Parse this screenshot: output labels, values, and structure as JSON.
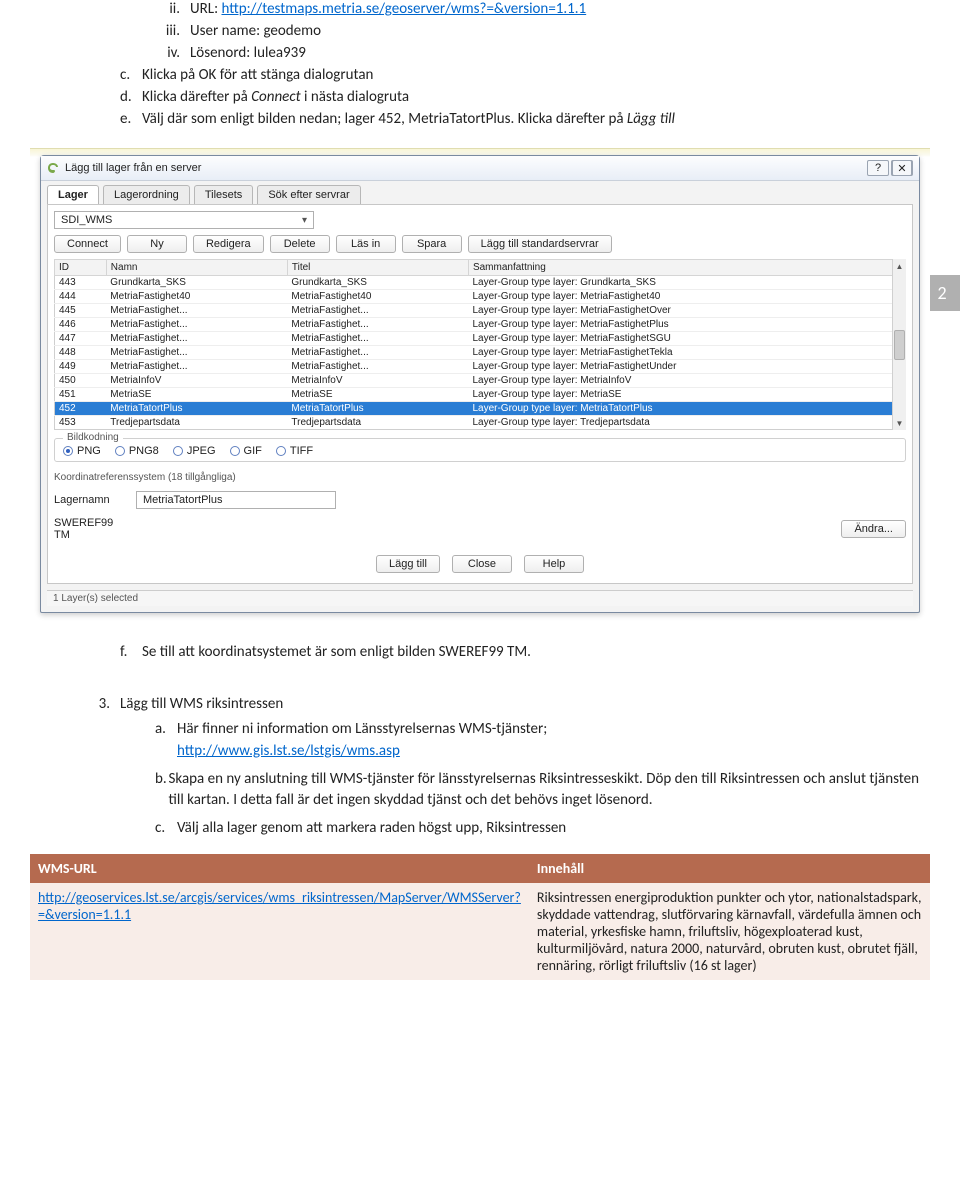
{
  "instr_top": {
    "ii_label": "ii.",
    "ii_prefix": "URL: ",
    "ii_link": "http://testmaps.metria.se/geoserver/wms?=&version=1.1.1",
    "iii_label": "iii.",
    "iii_text": "User name: geodemo",
    "iv_label": "iv.",
    "iv_text": "Lösenord: lulea939"
  },
  "letters_top": {
    "c_label": "c.",
    "c_text": "Klicka på OK för att stänga dialogrutan",
    "d_label": "d.",
    "d_prefix": "Klicka därefter på ",
    "d_italic": "Connect",
    "d_suffix": " i nästa dialogruta",
    "e_label": "e.",
    "e_prefix": "Välj där som enligt bilden nedan; lager 452, MetriaTatortPlus. Klicka därefter på ",
    "e_italic": "Lägg till"
  },
  "page_badge": "2",
  "dialog": {
    "title": "Lägg till lager från en server",
    "help_glyph": "?",
    "close_glyph": "✕",
    "tabs": [
      "Lager",
      "Lagerordning",
      "Tilesets",
      "Sök efter servrar"
    ],
    "server_selected": "SDI_WMS",
    "buttons": [
      "Connect",
      "Ny",
      "Redigera",
      "Delete",
      "Läs in",
      "Spara",
      "Lägg till standardservrar"
    ],
    "columns": [
      "ID",
      "Namn",
      "Titel",
      "Sammanfattning"
    ],
    "rows": [
      {
        "id": "443",
        "n": "Grundkarta_SKS",
        "t": "Grundkarta_SKS",
        "s": "Layer-Group type layer: Grundkarta_SKS"
      },
      {
        "id": "444",
        "n": "MetriaFastighet40",
        "t": "MetriaFastighet40",
        "s": "Layer-Group type layer: MetriaFastighet40"
      },
      {
        "id": "445",
        "n": "MetriaFastighet...",
        "t": "MetriaFastighet...",
        "s": "Layer-Group type layer: MetriaFastighetOver"
      },
      {
        "id": "446",
        "n": "MetriaFastighet...",
        "t": "MetriaFastighet...",
        "s": "Layer-Group type layer: MetriaFastighetPlus"
      },
      {
        "id": "447",
        "n": "MetriaFastighet...",
        "t": "MetriaFastighet...",
        "s": "Layer-Group type layer: MetriaFastighetSGU"
      },
      {
        "id": "448",
        "n": "MetriaFastighet...",
        "t": "MetriaFastighet...",
        "s": "Layer-Group type layer: MetriaFastighetTekla"
      },
      {
        "id": "449",
        "n": "MetriaFastighet...",
        "t": "MetriaFastighet...",
        "s": "Layer-Group type layer: MetriaFastighetUnder"
      },
      {
        "id": "450",
        "n": "MetriaInfoV",
        "t": "MetriaInfoV",
        "s": "Layer-Group type layer: MetriaInfoV"
      },
      {
        "id": "451",
        "n": "MetriaSE",
        "t": "MetriaSE",
        "s": "Layer-Group type layer: MetriaSE"
      },
      {
        "id": "452",
        "n": "MetriaTatortPlus",
        "t": "MetriaTatortPlus",
        "s": "Layer-Group type layer: MetriaTatortPlus",
        "selected": true
      },
      {
        "id": "453",
        "n": "Tredjepartsdata",
        "t": "Tredjepartsdata",
        "s": "Layer-Group type layer: Tredjepartsdata"
      }
    ],
    "encoding_legend": "Bildkodning",
    "encodings": [
      "PNG",
      "PNG8",
      "JPEG",
      "GIF",
      "TIFF"
    ],
    "crs_label": "Koordinatreferenssystem (18 tillgångliga)",
    "layername_label": "Lagernamn",
    "layername_value": "MetriaTatortPlus",
    "crs_value": "SWEREF99 TM",
    "change_btn": "Ändra...",
    "footer_buttons": [
      "Lägg till",
      "Close",
      "Help"
    ],
    "status": "1 Layer(s) selected"
  },
  "post_note": {
    "f_label": "f.",
    "f_text": "Se till att koordinatsystemet är som enligt bilden SWEREF99 TM."
  },
  "section3": {
    "num": "3.",
    "title": "Lägg till WMS riksintressen",
    "a_label": "a.",
    "a_line1": "Här finner ni information om Länsstyrelsernas WMS-tjänster;",
    "a_link": "http://www.gis.lst.se/lstgis/wms.asp",
    "b_label": "b.",
    "b_text": "Skapa en ny anslutning till WMS-tjänster för länsstyrelsernas Riksintresseskikt. Döp den till Riksintressen och anslut tjänsten till kartan. I detta fall är det ingen skyddad tjänst och det behövs inget lösenord.",
    "c_label": "c.",
    "c_text": "Välj alla lager genom att markera raden högst upp, Riksintressen"
  },
  "info_table": {
    "head_left": "WMS-URL",
    "head_right": "Innehåll",
    "cell_link": "http://geoservices.lst.se/arcgis/services/wms_riksintressen/MapServer/WMSServer?=&version=1.1.1",
    "cell_right": "Riksintressen energiproduktion punkter och ytor, nationalstadspark, skyddade vattendrag, slutförvaring kärnavfall, värdefulla ämnen och material, yrkesfiske hamn, friluftsliv, högexploaterad kust, kulturmiljövård, natura 2000, naturvård, obruten kust, obrutet fjäll, rennäring, rörligt friluftsliv (16 st lager)"
  }
}
